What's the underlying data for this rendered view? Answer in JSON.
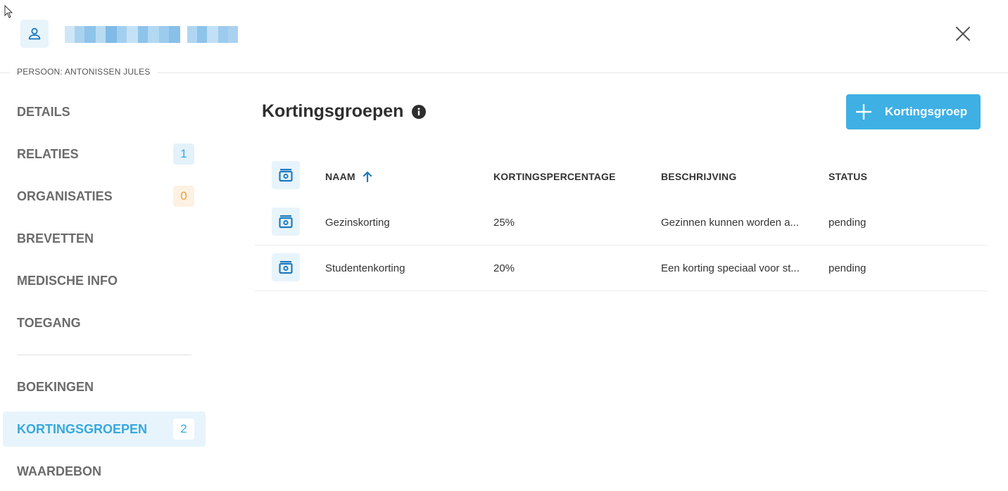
{
  "header": {
    "breadcrumb": "PERSOON: ANTONISSEN JULES"
  },
  "sidebar": {
    "items": [
      {
        "label": "DETAILS"
      },
      {
        "label": "RELATIES",
        "badge": "1"
      },
      {
        "label": "ORGANISATIES",
        "badge": "0"
      },
      {
        "label": "BREVETTEN"
      },
      {
        "label": "MEDISCHE INFO"
      },
      {
        "label": "TOEGANG"
      },
      {
        "label": "BOEKINGEN"
      },
      {
        "label": "KORTINGSGROEPEN",
        "badge": "2"
      },
      {
        "label": "WAARDEBON"
      }
    ],
    "active_item": "KORTINGSGROEPEN"
  },
  "main": {
    "title": "Kortingsgroepen",
    "add_button_label": "Kortingsgroep",
    "table": {
      "columns": [
        "NAAM",
        "KORTINGSPERCENTAGE",
        "BESCHRIJVING",
        "STATUS"
      ],
      "sort_column": "NAAM",
      "sort_direction": "ascending",
      "rows": [
        {
          "naam": "Gezinskorting",
          "percentage": "25%",
          "beschrijving": "Gezinnen kunnen worden a...",
          "status": "pending"
        },
        {
          "naam": "Studentenkorting",
          "percentage": "20%",
          "beschrijving": "Een korting speciaal voor st...",
          "status": "pending"
        }
      ]
    }
  },
  "colors": {
    "accent": "#3eb0e4",
    "accent_text": "#36a9dd",
    "icon_blue": "#1f7bbf",
    "badge_orange": "#f0a030",
    "light_blue_bg": "#e8f4fb"
  },
  "icons": {
    "avatar": "person-icon",
    "close": "close-icon",
    "info": "info-icon",
    "add": "plus-icon",
    "row": "discount-box-icon",
    "sort": "arrow-up-icon"
  }
}
